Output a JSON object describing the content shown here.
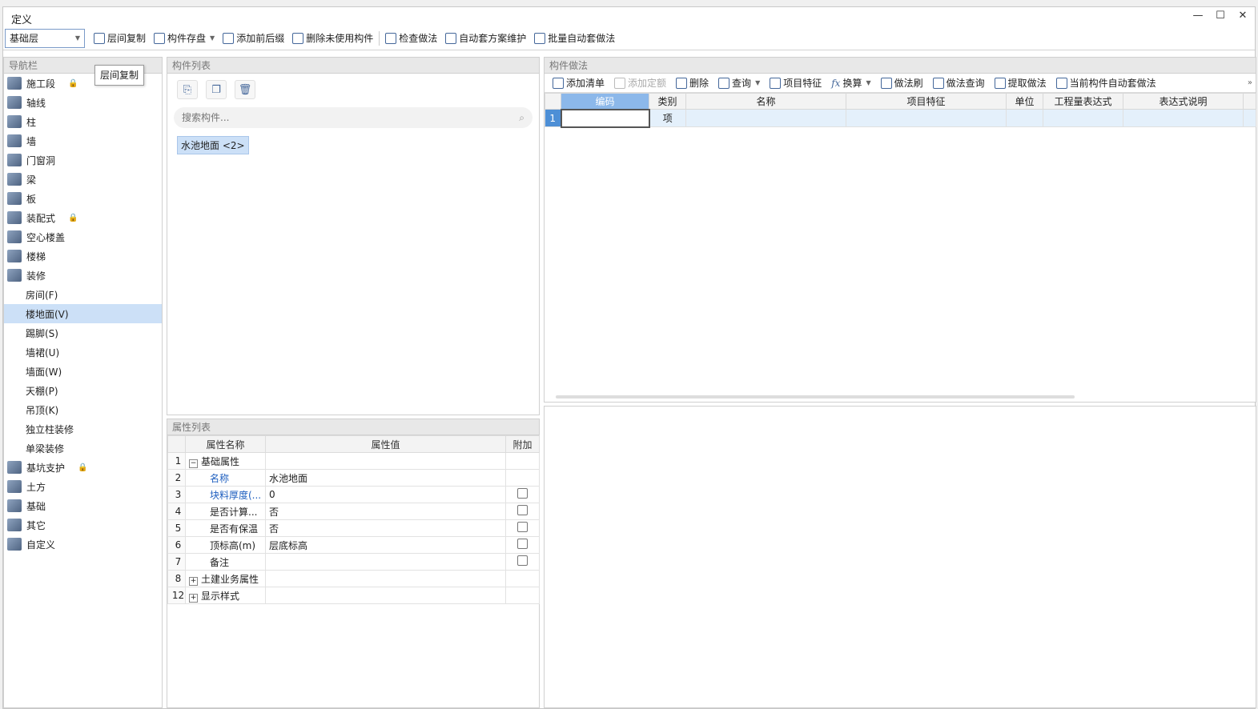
{
  "window": {
    "title": "定义"
  },
  "toolbar": {
    "floor_value": "基础层",
    "buttons": [
      "层间复制",
      "构件存盘",
      "添加前后缀",
      "删除未使用构件",
      "检查做法",
      "自动套方案维护",
      "批量自动套做法"
    ]
  },
  "tooltip": "层间复制",
  "nav": {
    "title": "导航栏",
    "items": [
      {
        "label": "施工段",
        "locked": true
      },
      {
        "label": "轴线"
      },
      {
        "label": "柱"
      },
      {
        "label": "墙"
      },
      {
        "label": "门窗洞"
      },
      {
        "label": "梁"
      },
      {
        "label": "板"
      },
      {
        "label": "装配式",
        "locked": true
      },
      {
        "label": "空心楼盖"
      },
      {
        "label": "楼梯"
      },
      {
        "label": "装修"
      }
    ],
    "subitems": [
      "房间(F)",
      "楼地面(V)",
      "踢脚(S)",
      "墙裙(U)",
      "墙面(W)",
      "天棚(P)",
      "吊顶(K)",
      "独立柱装修",
      "单梁装修"
    ],
    "selected_sub": "楼地面(V)",
    "items2": [
      {
        "label": "基坑支护",
        "locked": true
      },
      {
        "label": "土方"
      },
      {
        "label": "基础"
      },
      {
        "label": "其它"
      },
      {
        "label": "自定义"
      }
    ]
  },
  "component_list": {
    "title": "构件列表",
    "search_placeholder": "搜索构件...",
    "items": [
      "水池地面 <2>"
    ]
  },
  "property_list": {
    "title": "属性列表",
    "columns": [
      "属性名称",
      "属性值",
      "附加"
    ],
    "rows": [
      {
        "no": "1",
        "name": "基础属性",
        "value": "",
        "group": "minus",
        "checkbox": false,
        "blue": false
      },
      {
        "no": "2",
        "name": "名称",
        "value": "水池地面",
        "checkbox": false,
        "blue": true
      },
      {
        "no": "3",
        "name": "块料厚度(...",
        "value": "0",
        "checkbox": true,
        "blue": true
      },
      {
        "no": "4",
        "name": "是否计算...",
        "value": "否",
        "checkbox": true,
        "blue": false
      },
      {
        "no": "5",
        "name": "是否有保温",
        "value": "否",
        "checkbox": true,
        "blue": false
      },
      {
        "no": "6",
        "name": "顶标高(m)",
        "value": "层底标高",
        "checkbox": true,
        "blue": false
      },
      {
        "no": "7",
        "name": "备注",
        "value": "",
        "checkbox": true,
        "blue": false
      },
      {
        "no": "8",
        "name": "土建业务属性",
        "value": "",
        "group": "plus",
        "checkbox": false,
        "blue": false
      },
      {
        "no": "12",
        "name": "显示样式",
        "value": "",
        "group": "plus",
        "checkbox": false,
        "blue": false
      }
    ]
  },
  "method": {
    "title": "构件做法",
    "tools": [
      "添加清单",
      "添加定额",
      "删除",
      "查询",
      "项目特征",
      "换算",
      "做法刷",
      "做法查询",
      "提取做法",
      "当前构件自动套做法"
    ],
    "columns": [
      "编码",
      "类别",
      "名称",
      "项目特征",
      "单位",
      "工程量表达式",
      "表达式说明"
    ],
    "rows": [
      {
        "no": "1",
        "code": "",
        "type": "项"
      }
    ]
  }
}
